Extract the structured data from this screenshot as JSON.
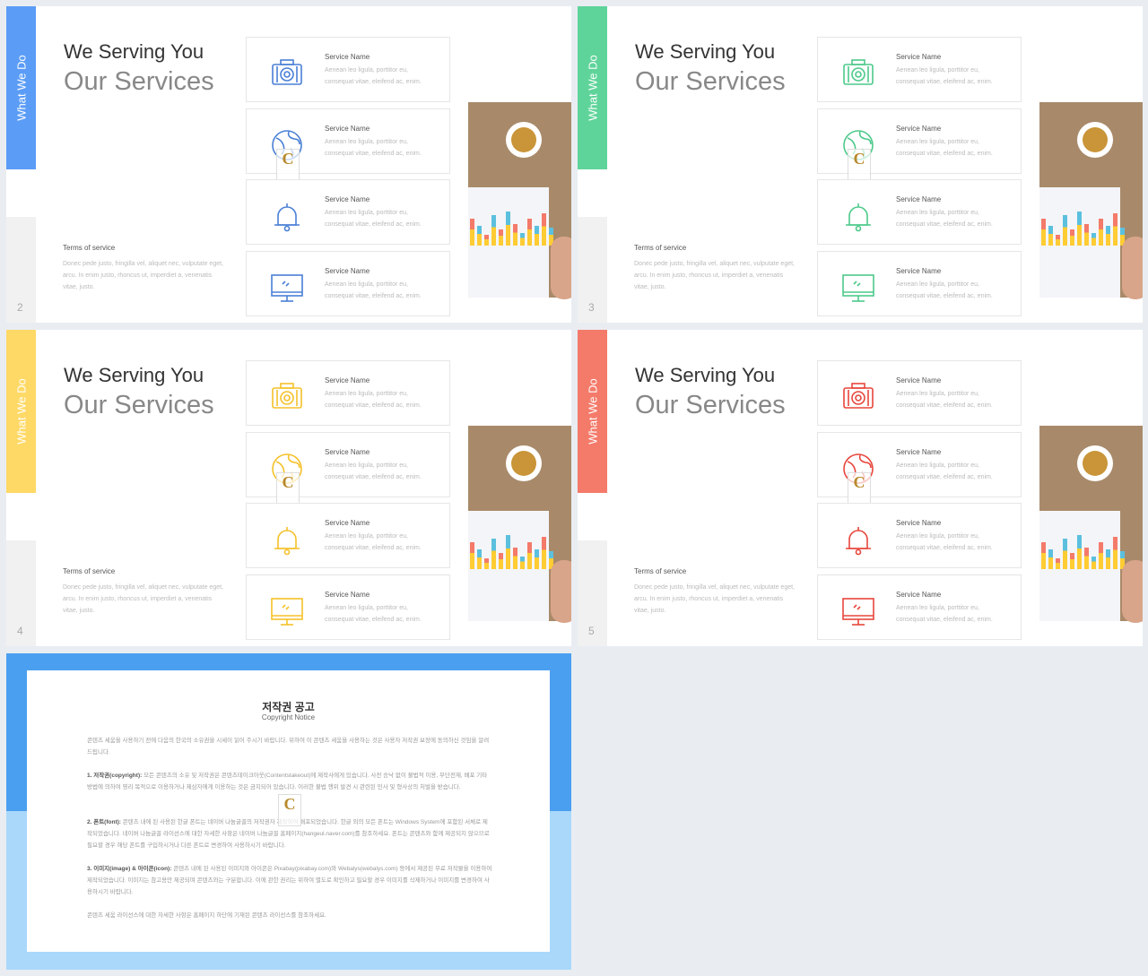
{
  "slides": [
    {
      "page": "2",
      "accent": "#5b9cf6",
      "icon_color": "#4a7fd6"
    },
    {
      "page": "3",
      "accent": "#5fd49a",
      "icon_color": "#4cc98a"
    },
    {
      "page": "4",
      "accent": "#ffd966",
      "icon_color": "#f5c12a"
    },
    {
      "page": "5",
      "accent": "#f47a6a",
      "icon_color": "#e8463c"
    }
  ],
  "slide_text": {
    "side_label": "What We Do",
    "title_line1": "We Serving You",
    "title_line2": "Our Services",
    "terms_title": "Terms of service",
    "terms_desc": "Donec pede justo, fringilla vel, aliquet nec, vulputate eget, arcu. In enim justo, rhoncus ut, imperdiet a, venenatis vitae, justo.",
    "services": [
      {
        "icon": "camera-icon",
        "name": "Service Name",
        "desc": "Aenean leo ligula, porttitor eu, consequat vitae, eleifend ac, enim."
      },
      {
        "icon": "globe-icon",
        "name": "Service Name",
        "desc": "Aenean leo ligula, porttitor eu, consequat vitae, eleifend ac, enim."
      },
      {
        "icon": "bell-icon",
        "name": "Service Name",
        "desc": "Aenean leo ligula, porttitor eu, consequat vitae, eleifend ac, enim."
      },
      {
        "icon": "monitor-icon",
        "name": "Service Name",
        "desc": "Aenean leo ligula, porttitor eu, consequat vitae, eleifend ac, enim."
      }
    ]
  },
  "copyright": {
    "title": "저작권 공고",
    "subtitle": "Copyright Notice",
    "intro": "콘텐츠 세움을 사용하기 전에 다음의 한국의 소유권을 시세이 읽어 주시기 바랍니다. 위하여 이 콘텐츠 세움을 사용하는 것은 사용자 저작권 보장에 동의하신 것임을 알려드립니다.",
    "p1_head": "1. 저작권(copyright):",
    "p1": "모든 콘텐츠의 소유 및 저작권은 콘텐츠테이크아웃(Contentstakeout)에 제작사에게 있습니다. 사전 승낙 없이 불법적 이용, 무단전재, 배포 기타 방법에 의하여 영리 목적으로 이용하거나 제삼자에게 이용하는 것은 금지되어 있습니다. 이러한 불법 행위 발견 시 관련된 민사 및 형사상의 처벌을 받습니다.",
    "p2_head": "2. 폰트(font):",
    "p2": "콘텐츠 내에 된 사용된 한글 폰트는 네이버 나눔글꼴의 저작권자 제작하여 배포되었습니다. 한글 외의 모든 폰트는 Windows System에 포함된 서체로 제작되었습니다. 네이버 나눔글꼴 라이선스에 대한 자세한 사항은 네이버 나눔글꼴 홈페이지(hangeul.naver.com)를 참조하세요. 폰트는 콘텐츠와 함께 제공되지 않으므로 필요할 경우 해당 폰트를 구입하시거나 다른 폰트로 변경하여 사용하시기 바랍니다.",
    "p3_head": "3. 이미지(image) & 아이콘(icon):",
    "p3": "콘텐츠 내에 된 사용된 이미지와 아이콘은 Pixabay(pixabay.com)와 Webalys(webalys.com) 등에서 제공된 무료 저작물을 이용하여 제작되었습니다. 이미지는 참고용만 제공되며 콘텐츠와는 구분합니다. 이에 관한 권리는 위하여 별도로 확인하고 필요할 경우 이미지를 삭제하거나 이미지를 변경하여 사용하시기 바랍니다.",
    "outro": "콘텐츠 세움 라이선스에 대한 자세한 사항은 홈페이지 하단에 기재된 콘텐츠 라이선스를 참조하세요."
  }
}
